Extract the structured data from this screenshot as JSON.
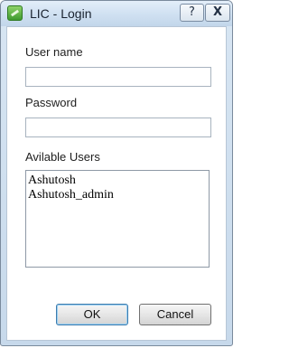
{
  "window": {
    "title": "LIC - Login",
    "help_glyph": "?",
    "close_glyph": "X",
    "icon": "app-icon"
  },
  "form": {
    "username_label": "User name",
    "username_value": "",
    "password_label": "Password",
    "password_value": "",
    "users_label": "Avilable Users",
    "users": [
      {
        "label": "Ashutosh"
      },
      {
        "label": "Ashutosh_admin"
      }
    ]
  },
  "buttons": {
    "ok_label": "OK",
    "cancel_label": "Cancel"
  },
  "colors": {
    "title_bar": "#cfe0f1",
    "default_button_border": "#3d7bad"
  }
}
